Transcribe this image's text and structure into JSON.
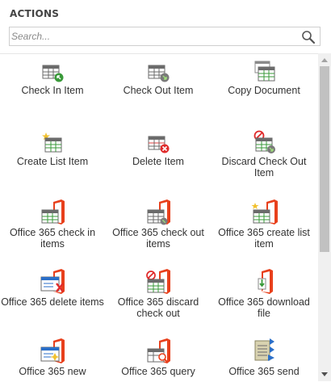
{
  "panel": {
    "title": "ACTIONS"
  },
  "search": {
    "placeholder": "Search...",
    "value": ""
  },
  "actions": [
    {
      "label": "Check In Item",
      "icon": "check-in-item-icon"
    },
    {
      "label": "Check Out Item",
      "icon": "check-out-item-icon"
    },
    {
      "label": "Copy Document",
      "icon": "copy-document-icon"
    },
    {
      "label": "Create List Item",
      "icon": "create-list-item-icon"
    },
    {
      "label": "Delete Item",
      "icon": "delete-item-icon"
    },
    {
      "label": "Discard Check Out Item",
      "icon": "discard-check-out-item-icon"
    },
    {
      "label": "Office 365 check in items",
      "icon": "office365-check-in-icon"
    },
    {
      "label": "Office 365 check out items",
      "icon": "office365-check-out-icon"
    },
    {
      "label": "Office 365 create list item",
      "icon": "office365-create-list-item-icon"
    },
    {
      "label": "Office 365 delete items",
      "icon": "office365-delete-items-icon"
    },
    {
      "label": "Office 365 discard check out",
      "icon": "office365-discard-check-out-icon"
    },
    {
      "label": "Office 365 download file",
      "icon": "office365-download-file-icon"
    },
    {
      "label": "Office 365 new",
      "icon": "office365-new-icon"
    },
    {
      "label": "Office 365 query",
      "icon": "office365-query-icon"
    },
    {
      "label": "Office 365 send",
      "icon": "office365-send-icon"
    }
  ],
  "colors": {
    "office_red": "#e8401c",
    "table_gray": "#6b6b6b",
    "table_green": "#3a9a3a",
    "accent_blue": "#2b6fc8"
  }
}
